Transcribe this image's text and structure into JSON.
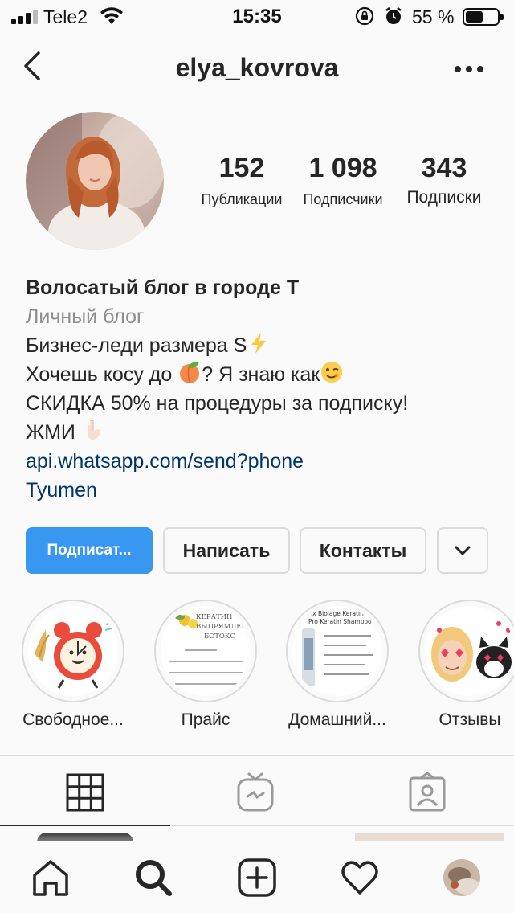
{
  "status_bar": {
    "carrier": "Tele2",
    "time": "15:35",
    "battery_percent": "55 %",
    "battery_level": 0.55
  },
  "header": {
    "username": "elya_kovrova"
  },
  "stats": [
    {
      "value": "152",
      "label": "Публикации"
    },
    {
      "value": "1 098",
      "label": "Подписчики"
    },
    {
      "value": "343",
      "label": "Подписки"
    }
  ],
  "bio": {
    "name": "Волосатый блог в городе Т",
    "category": "Личный блог",
    "line1": "Бизнес-леди размера S",
    "line2a": "Хочешь косу до ",
    "line2b": "? Я знаю как",
    "line3": "СКИДКА 50% на процедуры за подписку!",
    "line4": "ЖМИ ",
    "link": "api.whatsapp.com/send?phone",
    "location": "Tyumen"
  },
  "buttons": {
    "follow": "Подписат...",
    "message": "Написать",
    "contacts": "Контакты"
  },
  "highlights": [
    {
      "label": "Свободное..."
    },
    {
      "label": "Прайс"
    },
    {
      "label": "Домашний..."
    },
    {
      "label": "Отзывы"
    }
  ],
  "highlight_texts": {
    "price_title1": "КЕРАТИН",
    "price_title2": "ВЫПРЯМЛЕНИЕ",
    "price_title3": "БОТОКС",
    "care_title1": "rix Biolage Keratin",
    "care_title2": "Pro Keratin Shampoo"
  },
  "colors": {
    "accent": "#3897f0",
    "link": "#003569",
    "muted": "#8e8e8e",
    "border": "#dbdbdb",
    "text": "#262626"
  },
  "icons": {
    "back": "chevron-left-icon",
    "more": "more-horizontal-icon",
    "grid": "grid-icon",
    "igtv": "igtv-icon",
    "tagged": "tagged-icon",
    "home": "home-icon",
    "search": "search-icon",
    "add": "add-post-icon",
    "activity": "heart-icon"
  }
}
